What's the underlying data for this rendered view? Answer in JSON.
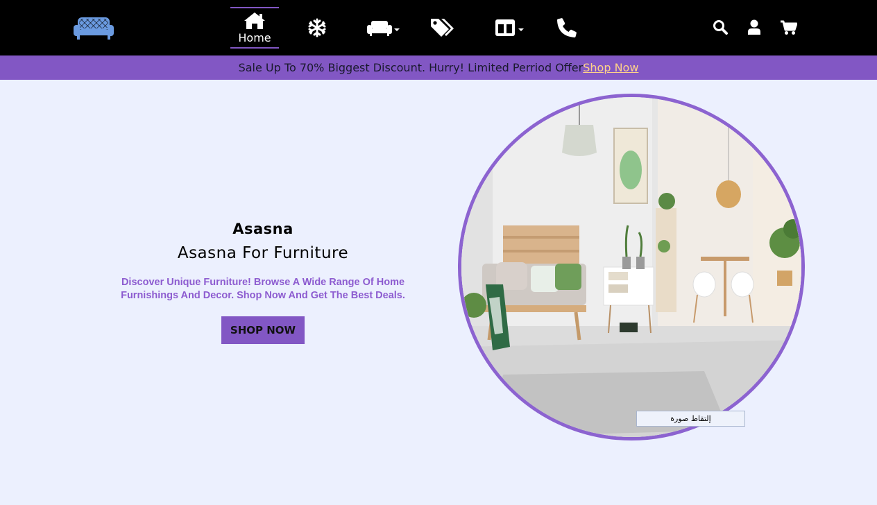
{
  "nav": {
    "logo_icon": "sofa-icon",
    "home_icon": "home-icon",
    "home_label": "Home",
    "items": [
      {
        "icon": "snowflake-icon"
      },
      {
        "icon": "couch-icon",
        "dropdown": true
      },
      {
        "icon": "tags-icon"
      },
      {
        "icon": "columns-icon",
        "dropdown": true
      },
      {
        "icon": "phone-icon"
      }
    ],
    "right_icons": [
      "search-icon",
      "user-icon",
      "cart-icon"
    ]
  },
  "promo": {
    "text": "Sale Up To 70% Biggest Discount. Hurry! Limited Perriod Offer",
    "link": "Shop Now"
  },
  "hero": {
    "brand": "Asasna",
    "tagline": "Asasna For Furniture",
    "description": "Discover Unique Furniture! Browse A Wide Range Of Home Furnishings And Decor. Shop Now And Get The Best Deals.",
    "button": "SHOP NOW",
    "capture_label": "إلتقاط صورة"
  },
  "colors": {
    "navbar": "#000000",
    "accent": "#8257c4",
    "page_bg": "#ecf0fe",
    "logo": "#6a9ae0",
    "promo_link": "#ffd28a",
    "description": "#8d5cd0"
  }
}
